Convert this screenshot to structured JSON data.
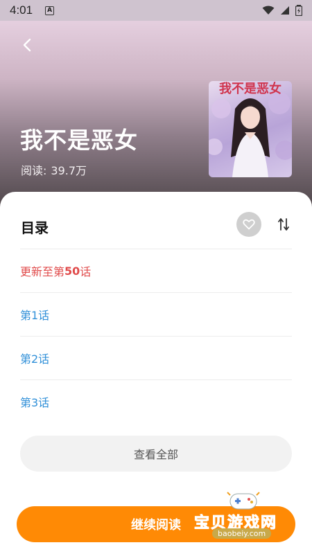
{
  "status_bar": {
    "time": "4:01",
    "notification_icon": "A",
    "icons": [
      "wifi-icon",
      "signal-icon",
      "battery-icon"
    ]
  },
  "header": {
    "book_title": "我不是恶女",
    "read_label": "阅读:",
    "read_count": "39.7万",
    "cover_title": "我不是恶女"
  },
  "toc": {
    "title": "目录",
    "update_prefix": "更新至第",
    "update_number": "50",
    "update_suffix": "话",
    "chapters": [
      "第1话",
      "第2话",
      "第3话"
    ],
    "view_all_label": "查看全部"
  },
  "footer": {
    "continue_label": "继续阅读"
  },
  "watermark": {
    "text": "宝贝游戏网",
    "url": "baobeiy.com"
  },
  "colors": {
    "accent": "#ff8a05",
    "update_red": "#e04a4a",
    "chapter_blue": "#2f8fd8"
  }
}
